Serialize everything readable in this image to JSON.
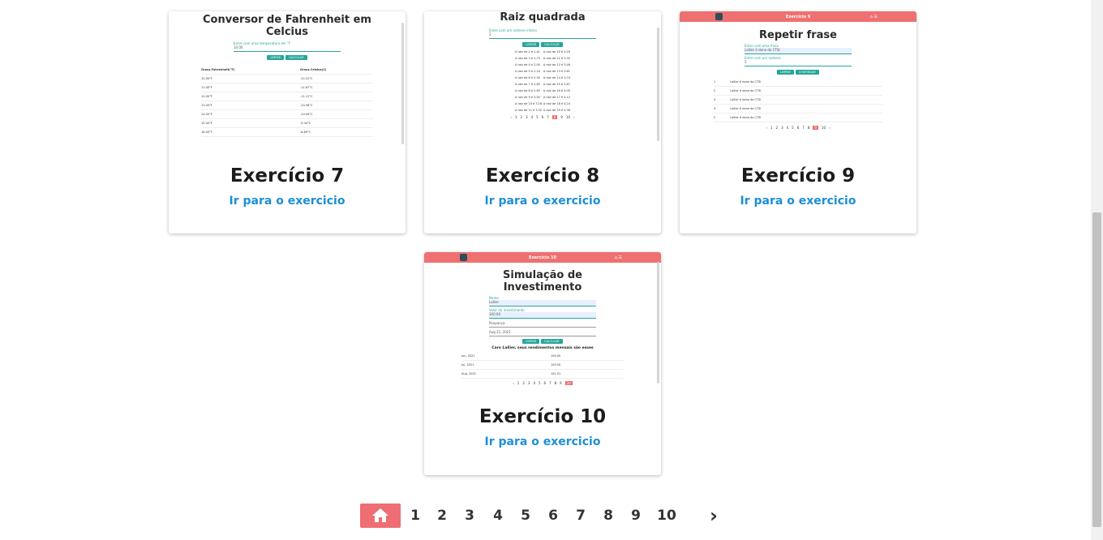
{
  "cards": [
    {
      "title": "Exercício 7",
      "link": "Ir para o exercicio",
      "thumb": {
        "heading": "Conversor de Fahrenheit em Celcius",
        "label": "Entre com uma temperatura em °F",
        "input": "10.00",
        "buttons": [
          "LIMPAR",
          "CALCULAR"
        ],
        "col_headers": [
          "Graus Fahrenheit(°F)",
          "Graus Celsius(C)"
        ],
        "rows": [
          [
            "10.00°F",
            "-12.22°C"
          ],
          [
            "11.00°F",
            "-11.67°C"
          ],
          [
            "12.00°F",
            "-11.11°C"
          ],
          [
            "13.00°F",
            "-10.56°C"
          ],
          [
            "14.00°F",
            "-10.00°C"
          ],
          [
            "15.00°F",
            "-9.44°C"
          ],
          [
            "16.00°F",
            "-8.89°C"
          ]
        ]
      }
    },
    {
      "title": "Exercício 8",
      "link": "Ir para o exercicio",
      "thumb": {
        "heading": "Raiz quadrada",
        "label": "Entre com um número inteiro",
        "input": "2",
        "buttons": [
          "LIMPAR",
          "CALCULAR"
        ],
        "rows": [
          [
            "A raiz de 2 é 1.41",
            "A raiz de 10 é 3.16"
          ],
          [
            "A raiz de 3 é 1.73",
            "A raiz de 11 é 3.32"
          ],
          [
            "A raiz de 4 é 2.00",
            "A raiz de 12 é 3.46"
          ],
          [
            "A raiz de 5 é 2.24",
            "A raiz de 13 é 3.61"
          ],
          [
            "A raiz de 6 é 2.45",
            "A raiz de 14 é 3.74"
          ],
          [
            "A raiz de 7 é 2.65",
            "A raiz de 15 é 3.87"
          ],
          [
            "A raiz de 8 é 2.83",
            "A raiz de 16 é 4.00"
          ],
          [
            "A raiz de 9 é 3.00",
            "A raiz de 17 é 4.12"
          ],
          [
            "A raiz de 10 é 3.16",
            "A raiz de 18 é 4.24"
          ],
          [
            "A raiz de 11 é 3.32",
            "A raiz de 19 é 4.36"
          ],
          [
            "A raiz de 12 é 3.46",
            "A raiz de 20 é 4.47"
          ]
        ],
        "pages": [
          "‹",
          "1",
          "2",
          "3",
          "4",
          "5",
          "6",
          "7",
          "8",
          "9",
          "10",
          "›"
        ],
        "active_page": "8"
      }
    },
    {
      "title": "Exercício 9",
      "link": "Ir para o exercicio",
      "thumb": {
        "nav_title": "Exercício 9",
        "heading": "Repetir frase",
        "label1": "Entre com uma frase",
        "input1": "Lallier é dono do CTSI",
        "label2": "Entre com um número",
        "input2": "5",
        "buttons": [
          "LIMPAR",
          "CONTINUAR"
        ],
        "rows": [
          [
            "1",
            "Lallier é dono do CTSI"
          ],
          [
            "2",
            "Lallier é dono do CTSI"
          ],
          [
            "3",
            "Lallier é dono do CTSI"
          ],
          [
            "4",
            "Lallier é dono do CTSI"
          ],
          [
            "5",
            "Lallier é dono do CTSI"
          ]
        ],
        "pages": [
          "‹",
          "1",
          "2",
          "3",
          "4",
          "5",
          "6",
          "7",
          "8",
          "9",
          "10",
          "›"
        ],
        "active_page": "9"
      }
    },
    {
      "title": "Exercício 10",
      "link": "Ir para o exercicio",
      "thumb": {
        "nav_title": "Exercício 10",
        "heading": "Simulação de Investimento",
        "label1": "Nome",
        "input1": "Lallier",
        "label2": "Valor do investimento",
        "input2": "100.00",
        "select": "Poupança",
        "date": "Aug 21, 2021",
        "buttons": [
          "LIMPAR",
          "CALCULAR"
        ],
        "result_title": "Caro Lallier, seus rendimentos mensais são esses",
        "rows": [
          [
            "Jun, 2021",
            "100.00"
          ],
          [
            "Jul, 2021",
            "100.50"
          ],
          [
            "Aug, 2021",
            "101.01"
          ]
        ],
        "pages": [
          "‹",
          "1",
          "2",
          "3",
          "4",
          "5",
          "6",
          "7",
          "8",
          "9",
          "10"
        ],
        "active_page": "10"
      }
    }
  ],
  "pagination": {
    "home_icon": "home-icon",
    "pages": [
      "1",
      "2",
      "3",
      "4",
      "5",
      "6",
      "7",
      "8",
      "9",
      "10"
    ],
    "next": "›",
    "active": "home",
    "active_color": "#ee6e73"
  },
  "colors": {
    "accent": "#ee6e73",
    "link": "#1d8fd6",
    "button": "#26a69a"
  }
}
